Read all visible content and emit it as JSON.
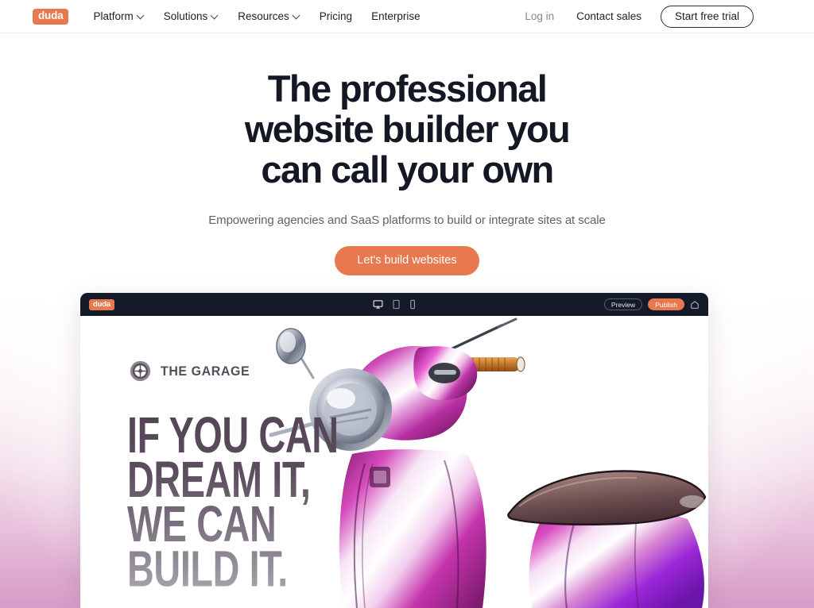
{
  "header": {
    "logo_text": "duda",
    "nav": [
      {
        "label": "Platform",
        "has_chevron": true,
        "icon": "chevron-down-icon"
      },
      {
        "label": "Solutions",
        "has_chevron": true,
        "icon": "chevron-down-icon"
      },
      {
        "label": "Resources",
        "has_chevron": true,
        "icon": "chevron-down-icon"
      },
      {
        "label": "Pricing",
        "has_chevron": false,
        "icon": ""
      },
      {
        "label": "Enterprise",
        "has_chevron": false,
        "icon": ""
      }
    ],
    "login_label": "Log in",
    "contact_label": "Contact sales",
    "trial_label": "Start free trial"
  },
  "hero": {
    "title_line1": "The professional",
    "title_line2": "website builder you",
    "title_line3": "can call your own",
    "subtitle": "Empowering agencies and SaaS platforms to build or integrate sites at scale",
    "cta_label": "Let's build websites"
  },
  "editor": {
    "logo_text": "duda",
    "devices": [
      {
        "name": "desktop-view-icon",
        "label": "Desktop",
        "active": true
      },
      {
        "name": "tablet-view-icon",
        "label": "Tablet",
        "active": false
      },
      {
        "name": "mobile-view-icon",
        "label": "Mobile",
        "active": false
      }
    ],
    "preview_label": "Preview",
    "publish_label": "Publish",
    "home_icon": "home-icon"
  },
  "mock_site": {
    "logo_icon": "wheel-icon",
    "logo_text": "THE GARAGE",
    "headline": "IF YOU CAN\nDREAM IT,\nWE CAN\nBUILD IT.",
    "hero_image_alt": "purple-scooter-image"
  },
  "colors": {
    "brand_orange": "#e8784e",
    "text_dark": "#141824",
    "text_muted": "#5e626c",
    "toolbar_dark": "#151a28",
    "headline_purple": "#544455",
    "page_gradient_bottom": "#d79cc8"
  }
}
